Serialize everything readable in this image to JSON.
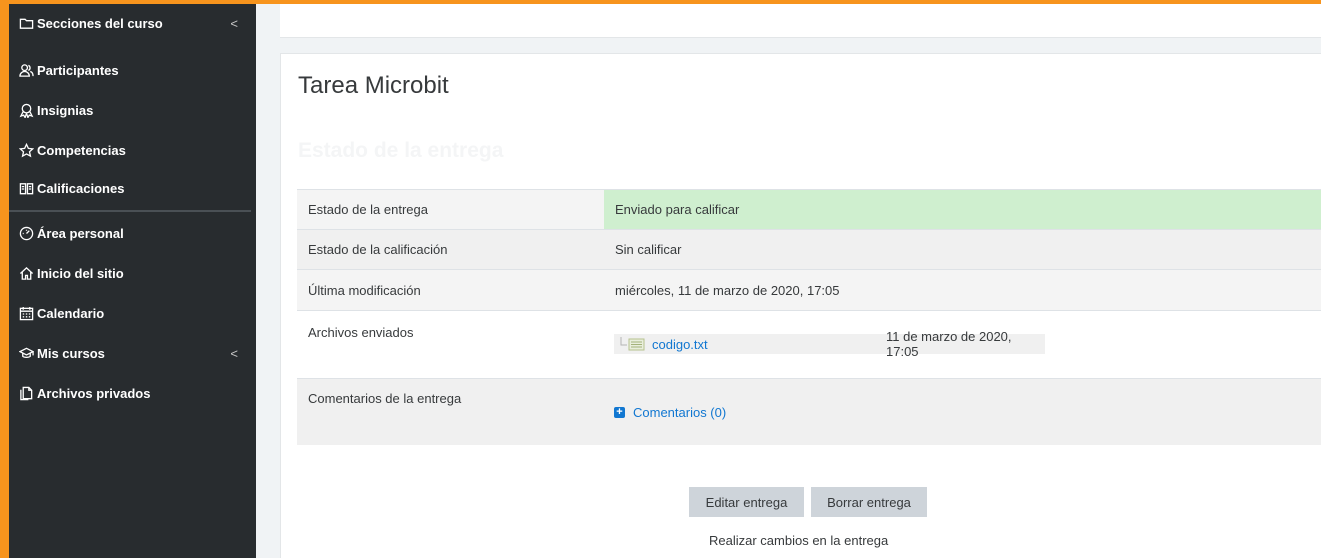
{
  "sidebar": {
    "items": [
      {
        "label": "Secciones del curso",
        "icon": "folder-icon",
        "chevron": "<"
      },
      {
        "label": "Participantes",
        "icon": "users-icon"
      },
      {
        "label": "Insignias",
        "icon": "badges-icon"
      },
      {
        "label": "Competencias",
        "icon": "star-icon"
      },
      {
        "label": "Calificaciones",
        "icon": "gradebook-icon"
      },
      {
        "label": "Área personal",
        "icon": "dashboard-icon"
      },
      {
        "label": "Inicio del sitio",
        "icon": "home-icon"
      },
      {
        "label": "Calendario",
        "icon": "calendar-icon"
      },
      {
        "label": "Mis cursos",
        "icon": "graduation-cap-icon",
        "chevron": "<"
      },
      {
        "label": "Archivos privados",
        "icon": "files-icon"
      }
    ]
  },
  "main": {
    "title": "Tarea Microbit",
    "section_heading": "Estado de la entrega",
    "status": {
      "submission_status_label": "Estado de la entrega",
      "submission_status_value": "Enviado para calificar",
      "grading_status_label": "Estado de la calificación",
      "grading_status_value": "Sin calificar",
      "last_modified_label": "Última modificación",
      "last_modified_value": "miércoles, 11 de marzo de 2020, 17:05",
      "files_label": "Archivos enviados",
      "file_name": "codigo.txt",
      "file_date": "11 de marzo de 2020, 17:05",
      "comments_label": "Comentarios de la entrega",
      "comments_link": "Comentarios (0)"
    },
    "buttons": {
      "edit": "Editar entrega",
      "delete": "Borrar entrega"
    },
    "helper_text": "Realizar cambios en la entrega"
  },
  "colors": {
    "accent_frame": "#f7941d",
    "sidebar_bg": "#282c2f",
    "submitted_bg": "#cfefcf",
    "link": "#1177d1"
  }
}
